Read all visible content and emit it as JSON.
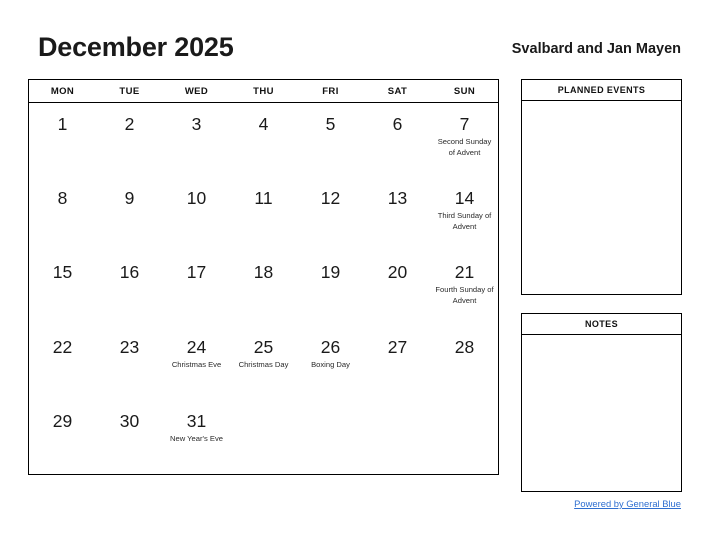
{
  "header": {
    "month_title": "December 2025",
    "country": "Svalbard and Jan Mayen"
  },
  "calendar": {
    "weekdays": [
      "MON",
      "TUE",
      "WED",
      "THU",
      "FRI",
      "SAT",
      "SUN"
    ],
    "weeks": [
      [
        {
          "date": "1",
          "event": ""
        },
        {
          "date": "2",
          "event": ""
        },
        {
          "date": "3",
          "event": ""
        },
        {
          "date": "4",
          "event": ""
        },
        {
          "date": "5",
          "event": ""
        },
        {
          "date": "6",
          "event": ""
        },
        {
          "date": "7",
          "event": "Second Sunday of Advent"
        }
      ],
      [
        {
          "date": "8",
          "event": ""
        },
        {
          "date": "9",
          "event": ""
        },
        {
          "date": "10",
          "event": ""
        },
        {
          "date": "11",
          "event": ""
        },
        {
          "date": "12",
          "event": ""
        },
        {
          "date": "13",
          "event": ""
        },
        {
          "date": "14",
          "event": "Third Sunday of Advent"
        }
      ],
      [
        {
          "date": "15",
          "event": ""
        },
        {
          "date": "16",
          "event": ""
        },
        {
          "date": "17",
          "event": ""
        },
        {
          "date": "18",
          "event": ""
        },
        {
          "date": "19",
          "event": ""
        },
        {
          "date": "20",
          "event": ""
        },
        {
          "date": "21",
          "event": "Fourth Sunday of Advent"
        }
      ],
      [
        {
          "date": "22",
          "event": ""
        },
        {
          "date": "23",
          "event": ""
        },
        {
          "date": "24",
          "event": "Christmas Eve"
        },
        {
          "date": "25",
          "event": "Christmas Day"
        },
        {
          "date": "26",
          "event": "Boxing Day"
        },
        {
          "date": "27",
          "event": ""
        },
        {
          "date": "28",
          "event": ""
        }
      ],
      [
        {
          "date": "29",
          "event": ""
        },
        {
          "date": "30",
          "event": ""
        },
        {
          "date": "31",
          "event": "New Year's Eve"
        },
        {
          "date": "",
          "event": ""
        },
        {
          "date": "",
          "event": ""
        },
        {
          "date": "",
          "event": ""
        },
        {
          "date": "",
          "event": ""
        }
      ]
    ]
  },
  "panels": {
    "planned_events": {
      "title": "PLANNED EVENTS",
      "content": ""
    },
    "notes": {
      "title": "NOTES",
      "content": ""
    }
  },
  "footer": {
    "link_label": "Powered by General Blue",
    "link_color": "#2f6fd0"
  }
}
